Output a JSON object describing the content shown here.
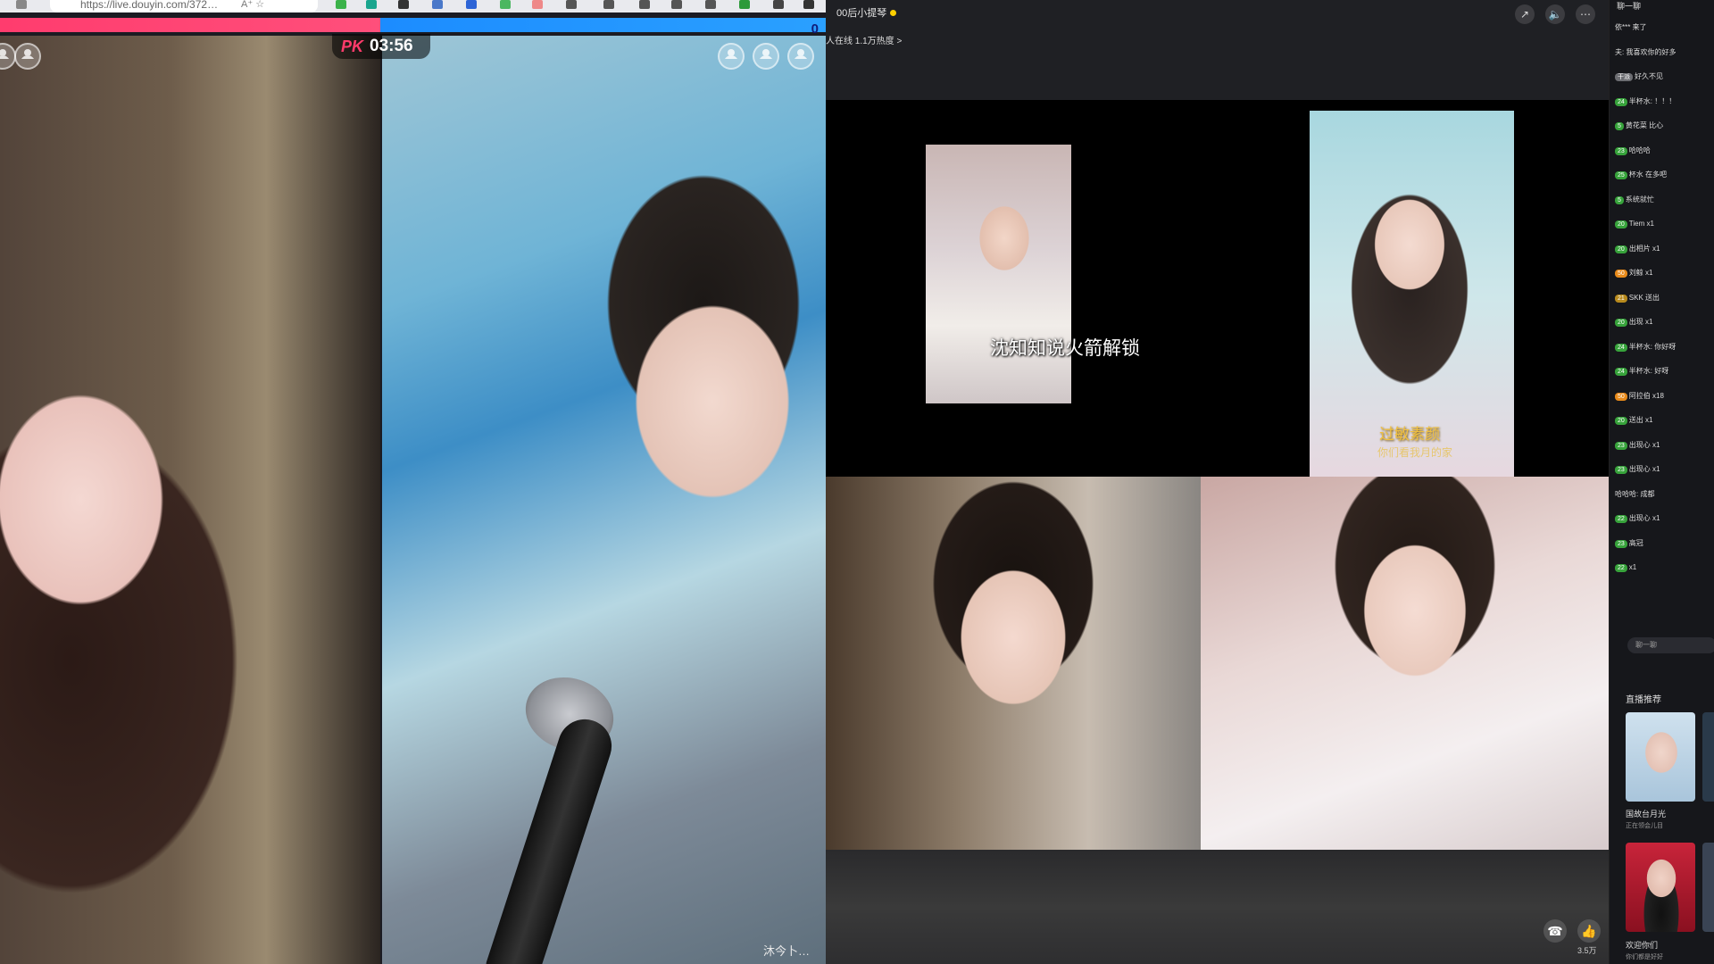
{
  "browser": {
    "url": "https://live.douyin.com/372…",
    "url_suffix": "A⁺ ☆"
  },
  "pk": {
    "logo": "PK",
    "timer": "03:56",
    "score_right": "0",
    "left_share_percent": 46,
    "right_anchor_label": "沐今卜…"
  },
  "stream": {
    "streamer_name": "00后小提琴",
    "stats": "人在线 1.1万热度 >",
    "share_icon": "share-icon",
    "caption_rocket": "沈知知说火箭解锁",
    "caption_overlay": "过敏素颜",
    "caption_overlay_sub": "你们看我月的家",
    "like_count": "3.5万"
  },
  "chat": {
    "title": "聊一聊",
    "messages": [
      {
        "text": "依*** 来了",
        "badge": "",
        "badge_color": ""
      },
      {
        "text": "夫: 我喜欢你的好多",
        "badge": "",
        "badge_color": ""
      },
      {
        "text": "好久不见",
        "badge": "干派",
        "badge_color": "gray"
      },
      {
        "text": "半杯水: ！！！",
        "badge": "24",
        "badge_color": "green"
      },
      {
        "text": "黄花菜 比心",
        "badge": "5",
        "badge_color": "green"
      },
      {
        "text": "哈哈哈",
        "badge": "23",
        "badge_color": "green"
      },
      {
        "text": "杯水 在多吧",
        "badge": "25",
        "badge_color": "green"
      },
      {
        "text": "系统就忙",
        "badge": "5",
        "badge_color": "green"
      },
      {
        "text": "Tiem x1",
        "badge": "20",
        "badge_color": "green"
      },
      {
        "text": "出相片 x1",
        "badge": "20",
        "badge_color": "green"
      },
      {
        "text": "刘鲸 x1",
        "badge": "50",
        "badge_color": "orange"
      },
      {
        "text": "SKK 送出",
        "badge": "21",
        "badge_color": "gold"
      },
      {
        "text": "出现 x1",
        "badge": "20",
        "badge_color": "green"
      },
      {
        "text": "半杯水: 你好呀",
        "badge": "24",
        "badge_color": "green"
      },
      {
        "text": "半杯水: 好呀",
        "badge": "24",
        "badge_color": "green"
      },
      {
        "text": "阿拉伯 x18",
        "badge": "50",
        "badge_color": "orange"
      },
      {
        "text": "送出 x1",
        "badge": "20",
        "badge_color": "green"
      },
      {
        "text": "出现心 x1",
        "badge": "23",
        "badge_color": "green"
      },
      {
        "text": "出现心 x1",
        "badge": "23",
        "badge_color": "green"
      },
      {
        "text": "哈哈哈: 成都",
        "badge": "",
        "badge_color": ""
      },
      {
        "text": "出现心 x1",
        "badge": "22",
        "badge_color": "green"
      },
      {
        "text": "高冠",
        "badge": "23",
        "badge_color": "green"
      },
      {
        "text": "x1",
        "badge": "22",
        "badge_color": "green"
      }
    ],
    "input_placeholder": "聊一聊",
    "recommend_title": "直播推荐",
    "recommend": [
      {
        "name": "国故台月光",
        "sub": "正在领会儿目"
      },
      {
        "name": "欢迎你们",
        "sub": "你们都是好好"
      }
    ]
  },
  "colors": {
    "pk_red": "#ff3c6e",
    "pk_blue": "#1c8cff",
    "online_dot": "#ffd000",
    "caption_gold": "#f0c040"
  }
}
